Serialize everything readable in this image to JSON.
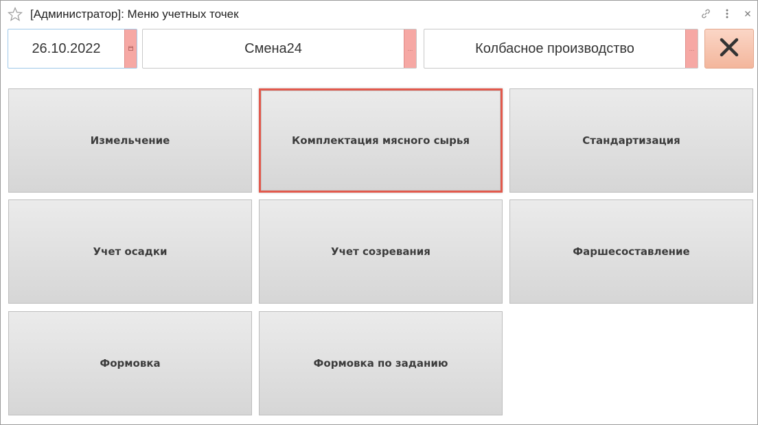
{
  "window": {
    "title": "[Администратор]: Меню учетных точек",
    "icons": [
      "star-icon",
      "link-icon",
      "more-vertical-icon",
      "close-icon"
    ]
  },
  "header": {
    "date_value": "26.10.2022",
    "date_button_icon": "calendar-icon",
    "shift_value": "Смена24",
    "shift_button_label": "...",
    "production_value": "Колбасное производство",
    "production_button_label": "...",
    "close_button_icon": "close-x-icon"
  },
  "menu": {
    "tiles": [
      {
        "label": "Измельчение"
      },
      {
        "label": "Комплектация мясного сырья",
        "selected": true
      },
      {
        "label": "Стандартизация"
      },
      {
        "label": "Учет осадки"
      },
      {
        "label": "Учет созревания"
      },
      {
        "label": "Фаршесоставление"
      },
      {
        "label": "Формовка"
      },
      {
        "label": "Формовка по заданию"
      }
    ]
  },
  "colors": {
    "field_button": "#f6a8a4",
    "close_button": "#f3b69c",
    "selection_border": "#e2594c",
    "tile_background": "#e0e0e0"
  }
}
